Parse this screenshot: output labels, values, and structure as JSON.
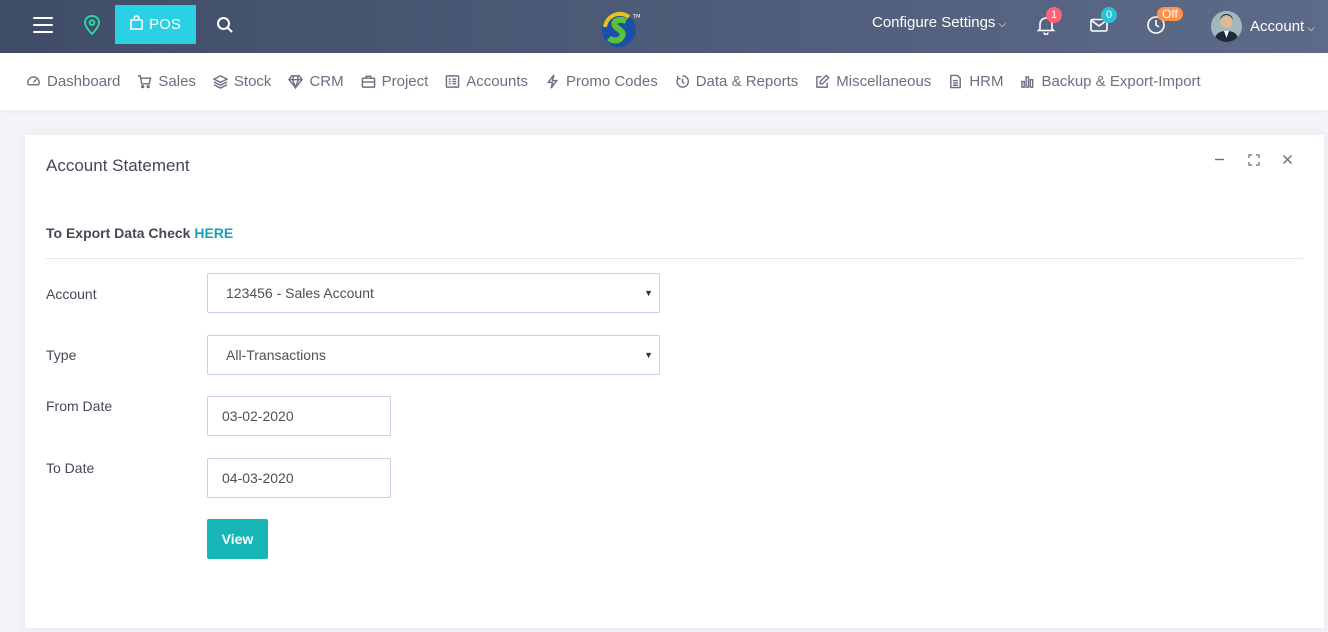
{
  "topbar": {
    "pos_label": "POS",
    "configure_label": "Configure Settings",
    "notifications_count": "1",
    "messages_count": "0",
    "clock_status": "Off",
    "account_label": "Account"
  },
  "nav": {
    "items": [
      {
        "label": "Dashboard",
        "icon": "dashboard-icon"
      },
      {
        "label": "Sales",
        "icon": "cart-icon"
      },
      {
        "label": "Stock",
        "icon": "layers-icon"
      },
      {
        "label": "CRM",
        "icon": "diamond-icon"
      },
      {
        "label": "Project",
        "icon": "briefcase-icon"
      },
      {
        "label": "Accounts",
        "icon": "ledger-icon"
      },
      {
        "label": "Promo Codes",
        "icon": "bolt-icon"
      },
      {
        "label": "Data & Reports",
        "icon": "timer-icon"
      },
      {
        "label": "Miscellaneous",
        "icon": "edit-icon"
      },
      {
        "label": "HRM",
        "icon": "document-icon"
      },
      {
        "label": "Backup & Export-Import",
        "icon": "bar-chart-icon"
      }
    ]
  },
  "card": {
    "title": "Account Statement",
    "export_text": "To Export Data Check",
    "export_link": "HERE",
    "account_label": "Account",
    "account_value": "123456 - Sales Account",
    "type_label": "Type",
    "type_value": "All-Transactions",
    "from_label": "From Date",
    "from_value": "03-02-2020",
    "to_label": "To Date",
    "to_value": "04-03-2020",
    "view_label": "View"
  },
  "colors": {
    "topbar": "#4a5773",
    "pos_button": "#2ad0e4",
    "view_button": "#17b5b5",
    "link": "#17a2b8"
  }
}
